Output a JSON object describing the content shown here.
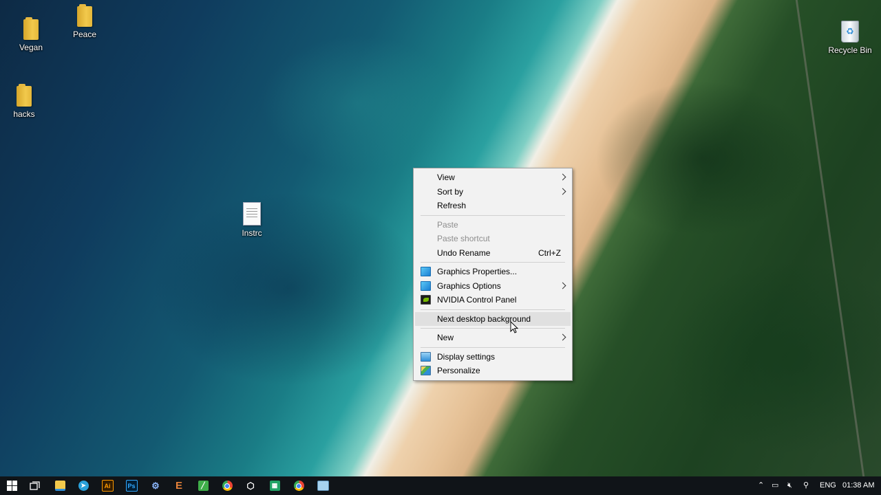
{
  "desktop": {
    "icons": [
      {
        "label": "Vegan",
        "type": "folder"
      },
      {
        "label": "Peace",
        "type": "folder"
      },
      {
        "label": "hacks",
        "type": "folder"
      },
      {
        "label": "Instrc",
        "type": "text-file"
      },
      {
        "label": "Recycle Bin",
        "type": "recycle-bin"
      }
    ]
  },
  "context_menu": {
    "items": [
      {
        "label": "View",
        "submenu": true
      },
      {
        "label": "Sort by",
        "submenu": true
      },
      {
        "label": "Refresh"
      },
      {
        "label": "Paste",
        "disabled": true
      },
      {
        "label": "Paste shortcut",
        "disabled": true
      },
      {
        "label": "Undo Rename",
        "shortcut": "Ctrl+Z"
      },
      {
        "label": "Graphics Properties...",
        "icon": "intel-graphics-icon"
      },
      {
        "label": "Graphics Options",
        "icon": "intel-graphics-icon",
        "submenu": true
      },
      {
        "label": "NVIDIA Control Panel",
        "icon": "nvidia-icon"
      },
      {
        "label": "Next desktop background",
        "hovered": true
      },
      {
        "label": "New",
        "submenu": true
      },
      {
        "label": "Display settings",
        "icon": "display-icon"
      },
      {
        "label": "Personalize",
        "icon": "personalize-icon"
      }
    ]
  },
  "taskbar": {
    "apps": [
      {
        "name": "start-button",
        "icon": "windows-logo"
      },
      {
        "name": "task-view",
        "icon": "task-view-icon"
      },
      {
        "name": "file-explorer",
        "icon": "folder-icon",
        "color": "#f2c94c"
      },
      {
        "name": "telegram",
        "icon": "telegram-icon",
        "color": "#2aa1da"
      },
      {
        "name": "illustrator",
        "icon": "illustrator-icon",
        "text": "Ai",
        "color": "#ff9a00"
      },
      {
        "name": "photoshop",
        "icon": "photoshop-icon",
        "text": "Ps",
        "color": "#31a8ff"
      },
      {
        "name": "network-app",
        "icon": "network-icon",
        "color": "#8ab4f8"
      },
      {
        "name": "e-app",
        "icon": "e-icon",
        "text": "E",
        "color": "#e8833a"
      },
      {
        "name": "green-app",
        "icon": "green-app-icon",
        "color": "#3fae49"
      },
      {
        "name": "chrome",
        "icon": "chrome-icon",
        "color": "#4285f4"
      },
      {
        "name": "box-app",
        "icon": "cube-icon",
        "color": "#ffffff"
      },
      {
        "name": "excel-like-app",
        "icon": "sheet-icon",
        "color": "#21a366"
      },
      {
        "name": "chrome-2",
        "icon": "chrome-icon",
        "color": "#4285f4"
      },
      {
        "name": "notepad",
        "icon": "notepad-icon",
        "color": "#a7d3ef"
      }
    ],
    "tray": {
      "language": "ENG",
      "time": "01:38 AM"
    }
  }
}
